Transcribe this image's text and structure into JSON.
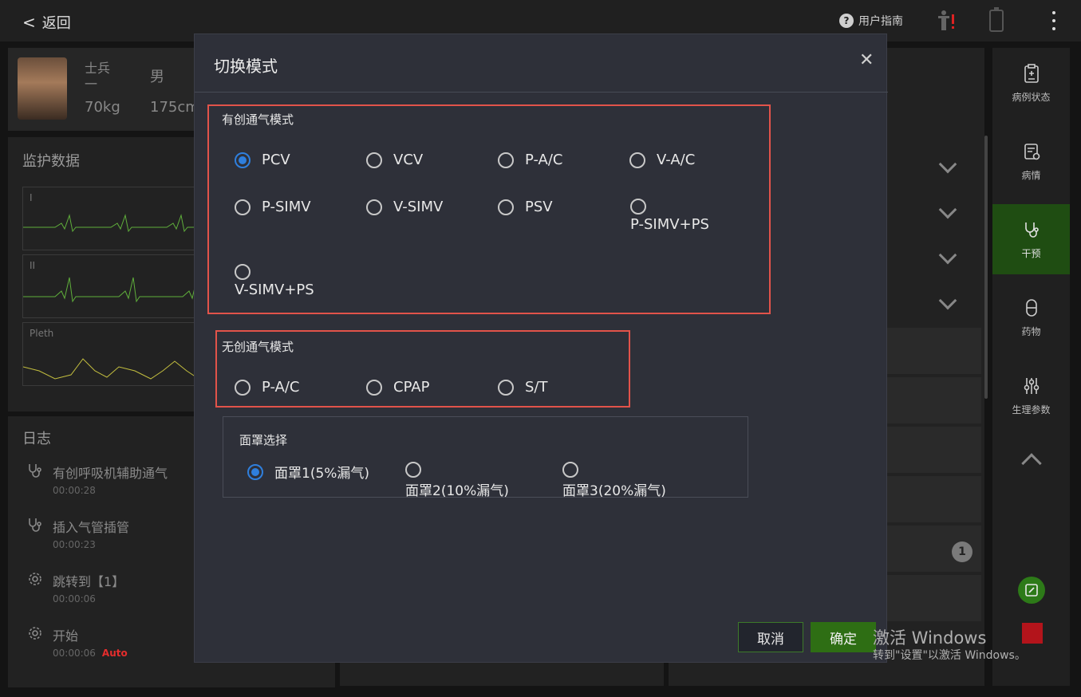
{
  "header": {
    "back_label": "返回",
    "guide_label": "用户指南"
  },
  "patient": {
    "name_line1": "士兵",
    "name_line2": "一",
    "gender": "男",
    "weight": "70kg",
    "height": "175cm"
  },
  "monitor": {
    "title": "监护数据",
    "waves": [
      "I",
      "II",
      "Pleth"
    ]
  },
  "log": {
    "title": "日志",
    "items": [
      {
        "text": "有创呼吸机辅助通气",
        "time": "00:00:28",
        "icon": "stethoscope-icon"
      },
      {
        "text": "插入气管插管",
        "time": "00:00:23",
        "icon": "stethoscope-icon"
      },
      {
        "text": "跳转到【1】",
        "time": "00:00:06",
        "icon": "gear-icon"
      },
      {
        "text": "开始",
        "time": "00:00:06",
        "icon": "gear-icon",
        "badge": "Auto"
      }
    ]
  },
  "rightnav": {
    "items": [
      {
        "label": "病例状态",
        "icon": "clipboard-icon",
        "active": false
      },
      {
        "label": "病情",
        "icon": "report-icon",
        "active": false
      },
      {
        "label": "干预",
        "icon": "stethoscope-icon",
        "active": true
      },
      {
        "label": "药物",
        "icon": "pill-icon",
        "active": false
      },
      {
        "label": "生理参数",
        "icon": "sliders-icon",
        "active": false
      }
    ]
  },
  "badge_count": "1",
  "dialog": {
    "title": "切换模式",
    "invasive": {
      "title": "有创通气模式",
      "options": [
        "PCV",
        "VCV",
        "P-A/C",
        "V-A/C",
        "P-SIMV",
        "V-SIMV",
        "PSV",
        "P-SIMV+PS",
        "V-SIMV+PS"
      ],
      "selected": "PCV"
    },
    "noninvasive": {
      "title": "无创通气模式",
      "options": [
        "P-A/C",
        "CPAP",
        "S/T"
      ],
      "selected": ""
    },
    "mask": {
      "title": "面罩选择",
      "options": [
        "面罩1(5%漏气)",
        "面罩2(10%漏气)",
        "面罩3(20%漏气)"
      ],
      "selected": "面罩1(5%漏气)"
    },
    "cancel_label": "取消",
    "confirm_label": "确定"
  },
  "watermark": {
    "line1": "激活 Windows",
    "line2": "转到\"设置\"以激活 Windows。"
  },
  "colors": {
    "accent_green": "#2e6e14",
    "radio_blue": "#2f7fdd",
    "highlight_red": "#e2534a",
    "stop_red": "#b3141b"
  }
}
